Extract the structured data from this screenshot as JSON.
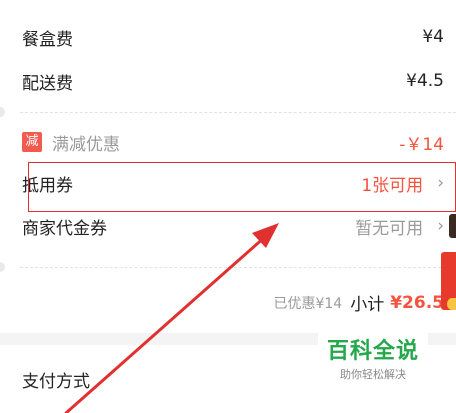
{
  "rows": {
    "box_fee": {
      "label": "餐盒费",
      "value": "¥4"
    },
    "delivery_fee": {
      "label": "配送费",
      "value": "¥4.5"
    },
    "discount": {
      "badge": "减",
      "label": "满减优惠",
      "value": "-￥14"
    },
    "voucher": {
      "label": "抵用券",
      "value": "1张可用",
      "chevron": "chevron-right-icon"
    },
    "merchant_coupon": {
      "label": "商家代金券",
      "value": "暂无可用",
      "chevron": "chevron-right-icon"
    }
  },
  "subtotal": {
    "saved": "已优惠¥14",
    "label": "小计",
    "amount": "¥26.5"
  },
  "payment": {
    "label": "支付方式"
  },
  "watermark": {
    "title": "百科全说",
    "subtitle": "助你轻松解决"
  },
  "colors": {
    "accent_red": "#f4533f",
    "annotation_red": "#e13030",
    "watermark_green": "#23a84a"
  }
}
